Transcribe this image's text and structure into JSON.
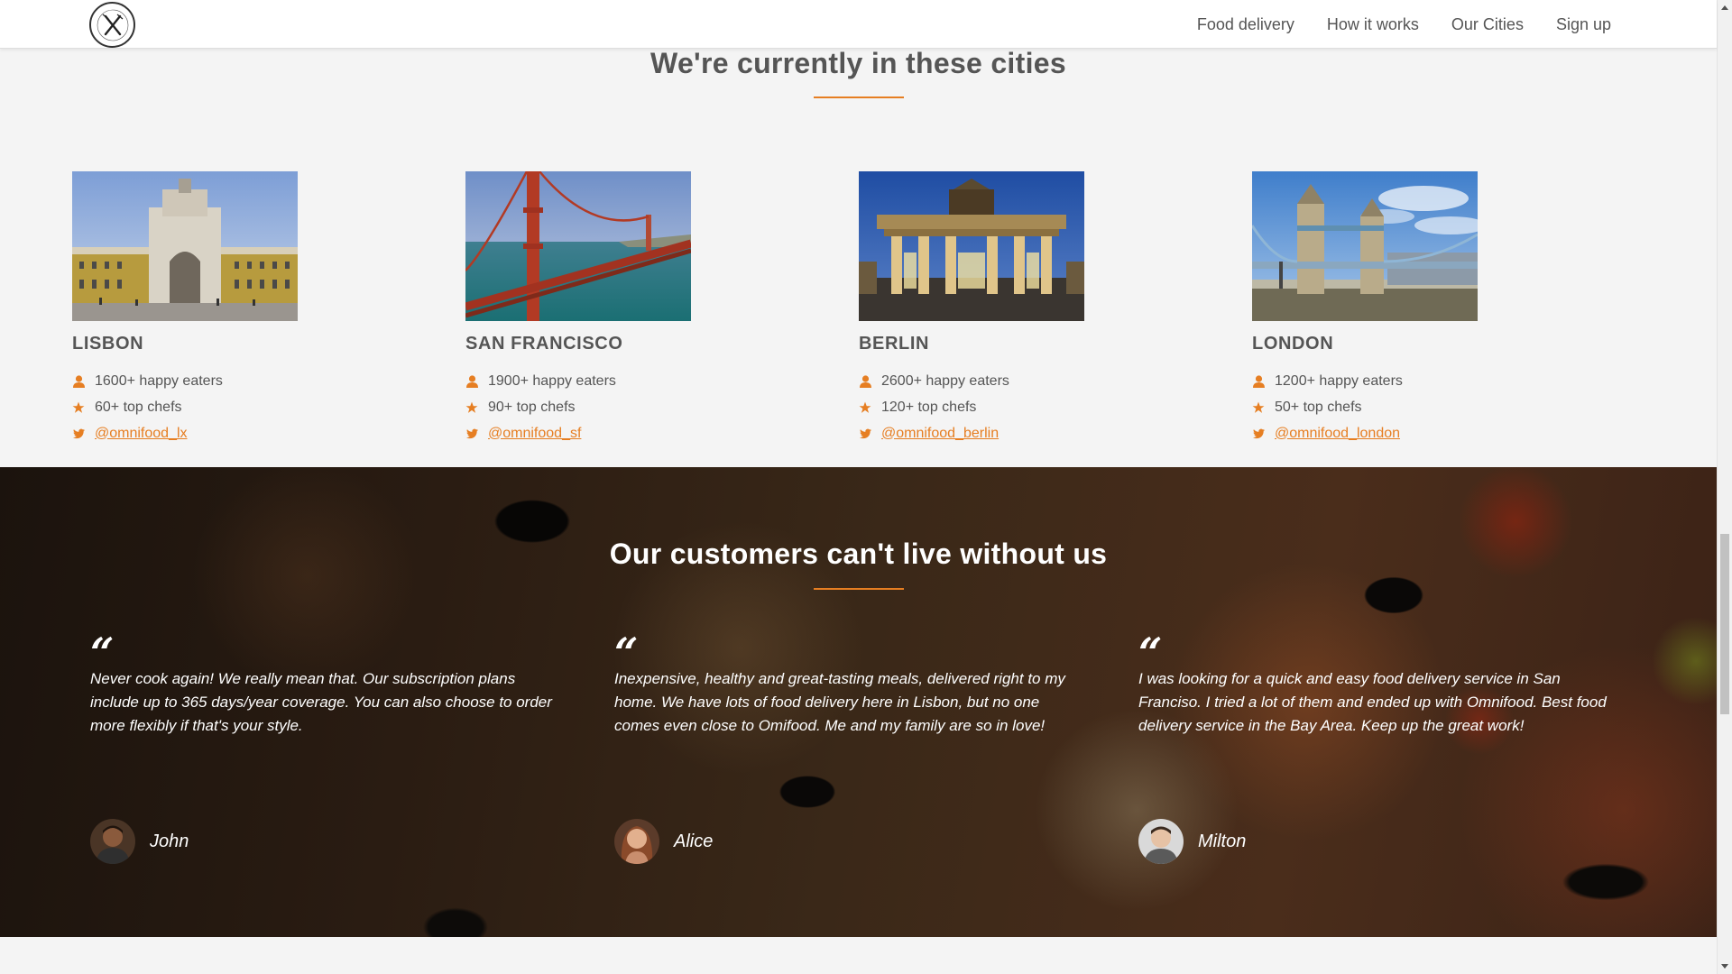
{
  "nav": {
    "items": [
      "Food delivery",
      "How it works",
      "Our Cities",
      "Sign up"
    ]
  },
  "cities": {
    "title": "We're currently in these cities",
    "list": [
      {
        "name": "Lisbon",
        "eaters": "1600+ happy eaters",
        "chefs": "60+ top chefs",
        "twitter": "@omnifood_lx"
      },
      {
        "name": "San Francisco",
        "eaters": "1900+ happy eaters",
        "chefs": "90+ top chefs",
        "twitter": "@omnifood_sf"
      },
      {
        "name": "Berlin",
        "eaters": "2600+ happy eaters",
        "chefs": "120+ top chefs",
        "twitter": "@omnifood_berlin"
      },
      {
        "name": "London",
        "eaters": "1200+ happy eaters",
        "chefs": "50+ top chefs",
        "twitter": "@omnifood_london"
      }
    ]
  },
  "testimonials": {
    "title": "Our customers can't live without us",
    "quote_mark": "“",
    "items": [
      {
        "text": "Never cook again! We really mean that. Our subscription plans include up to 365 days/year coverage. You can also choose to order more flexibly if that's your style.",
        "author": "John"
      },
      {
        "text": "Inexpensive, healthy and great-tasting meals, delivered right to my home. We have lots of food delivery here in Lisbon, but no one comes even close to Omifood. Me and my family are so in love!",
        "author": "Alice"
      },
      {
        "text": "I was looking for a quick and easy food delivery service in San Franciso. I tried a lot of them and ended up with Omnifood. Best food delivery service in the Bay Area. Keep up the great work!",
        "author": "Milton"
      }
    ]
  },
  "colors": {
    "accent": "#e67e22",
    "text": "#555555",
    "background": "#f4f4f4"
  },
  "icons": {
    "eaters": "person-icon",
    "chefs": "star-icon",
    "twitter": "twitter-icon"
  }
}
